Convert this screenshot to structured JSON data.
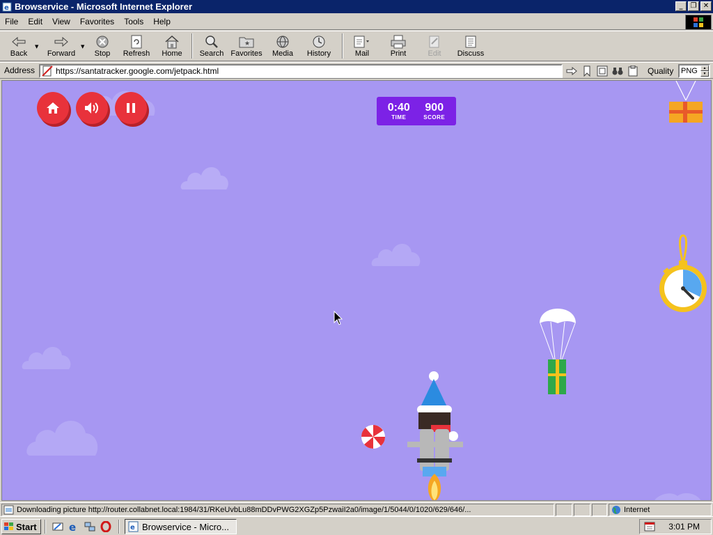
{
  "window": {
    "title": "Browservice - Microsoft Internet Explorer"
  },
  "menu": {
    "items": [
      {
        "label": "File"
      },
      {
        "label": "Edit"
      },
      {
        "label": "View"
      },
      {
        "label": "Favorites"
      },
      {
        "label": "Tools"
      },
      {
        "label": "Help"
      }
    ]
  },
  "toolbar": {
    "back": "Back",
    "forward": "Forward",
    "stop": "Stop",
    "refresh": "Refresh",
    "home": "Home",
    "search": "Search",
    "favorites": "Favorites",
    "media": "Media",
    "history": "History",
    "mail": "Mail",
    "print": "Print",
    "edit": "Edit",
    "discuss": "Discuss"
  },
  "address": {
    "label": "Address",
    "url": "https://santatracker.google.com/jetpack.html",
    "quality_label": "Quality",
    "quality_value": "PNG"
  },
  "game": {
    "time_value": "0:40",
    "time_label": "TIME",
    "score_value": "900",
    "score_label": "SCORE",
    "colors": {
      "sky": "#a797f2",
      "button_red": "#e8323b",
      "hud_purple": "#7c22e6"
    }
  },
  "status": {
    "text": "Downloading picture http://router.collabnet.local:1984/31/RKeUvbLu88mDDvPWG2XGZp5PzwaiI2a0/image/1/5044/0/1020/629/646/...",
    "zone": "Internet"
  },
  "taskbar": {
    "start_label": "Start",
    "task_label": "Browservice - Micro...",
    "clock": "3:01 PM"
  }
}
